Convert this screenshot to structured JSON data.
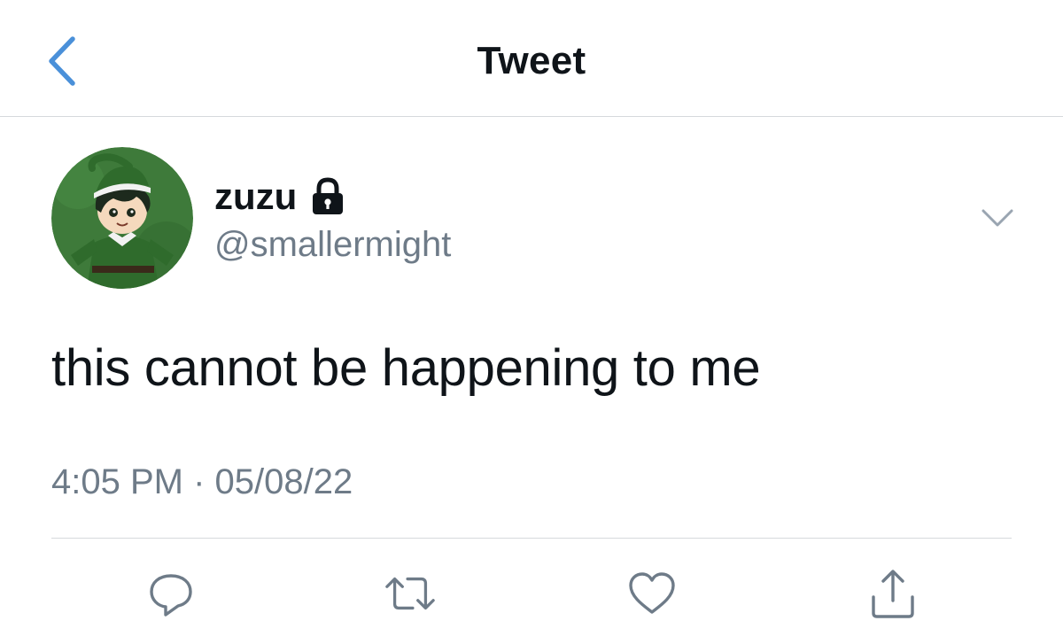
{
  "header": {
    "title": "Tweet",
    "back_icon": "chevron-left-icon",
    "accent_color": "#4a90d9"
  },
  "tweet": {
    "author": {
      "display_name": "zuzu",
      "handle": "@smallermight",
      "protected_icon": "lock-icon"
    },
    "text": "this cannot be happening to me",
    "time": "4:05 PM",
    "separator": "·",
    "date": "05/08/22",
    "menu_icon": "chevron-down-icon"
  },
  "actions": [
    {
      "icon": "reply-icon"
    },
    {
      "icon": "retweet-icon"
    },
    {
      "icon": "like-icon"
    },
    {
      "icon": "share-icon"
    }
  ],
  "colors": {
    "text": "#0f1419",
    "muted": "#6e7b88",
    "divider": "#d6d9dc",
    "icon": "#6e7b88"
  }
}
